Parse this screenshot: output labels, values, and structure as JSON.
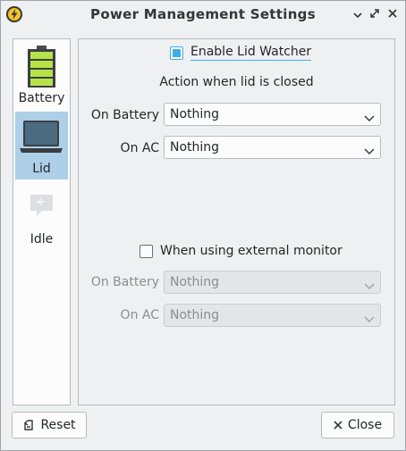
{
  "window": {
    "title": "Power Management Settings",
    "app_icon": "lightning-bolt-icon",
    "title_buttons": [
      "minimize-icon",
      "maximize-icon",
      "close-icon"
    ]
  },
  "sidebar": {
    "items": [
      {
        "label": "Battery",
        "icon": "battery-icon",
        "selected": false
      },
      {
        "label": "Lid",
        "icon": "laptop-icon",
        "selected": true
      },
      {
        "label": "Idle",
        "icon": "idle-icon",
        "selected": false
      }
    ]
  },
  "lid": {
    "enable_watcher": {
      "label": "Enable Lid Watcher",
      "checked": true
    },
    "heading": "Action when lid is closed",
    "on_battery": {
      "label": "On Battery",
      "value": "Nothing"
    },
    "on_ac": {
      "label": "On AC",
      "value": "Nothing"
    },
    "external_monitor": {
      "label": "When using external monitor",
      "checked": false
    },
    "ext_on_battery": {
      "label": "On Battery",
      "value": "Nothing",
      "disabled": true
    },
    "ext_on_ac": {
      "label": "On AC",
      "value": "Nothing",
      "disabled": true
    }
  },
  "footer": {
    "reset_label": "Reset",
    "close_label": "Close"
  },
  "colors": {
    "accent": "#3daee9",
    "selection": "#aecfe8",
    "window_bg": "#eff0f1"
  }
}
